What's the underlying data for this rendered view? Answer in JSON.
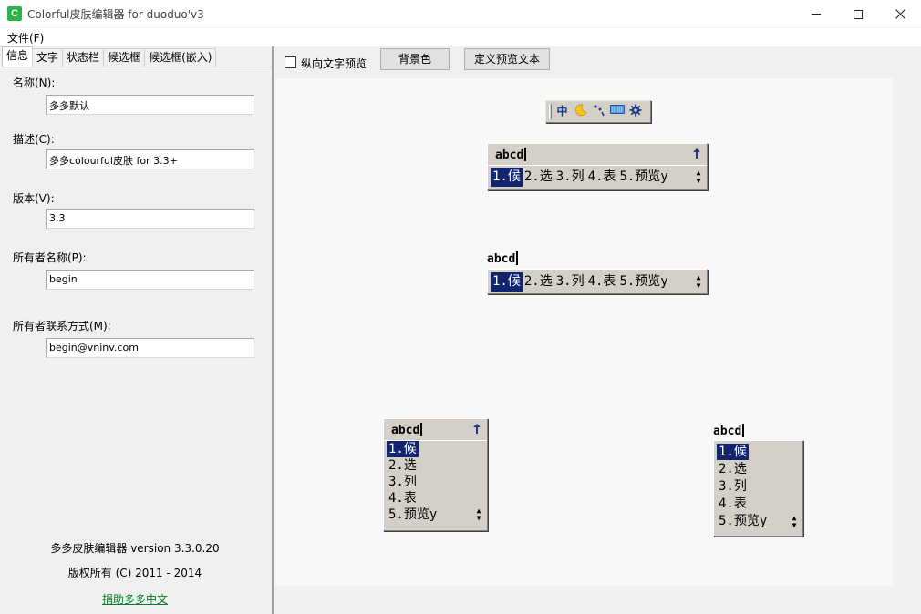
{
  "window": {
    "title": "Colorful皮肤编辑器 for duoduo'v3",
    "app_icon": "C"
  },
  "menu": {
    "file": "文件(F)"
  },
  "tabs": [
    "信息",
    "文字",
    "状态栏",
    "候选框",
    "候选框(嵌入)"
  ],
  "info": {
    "name_label": "名称(N):",
    "name_value": "多多默认",
    "desc_label": "描述(C):",
    "desc_value": "多多colourful皮肤 for 3.3+",
    "version_label": "版本(V):",
    "version_value": "3.3",
    "owner_label": "所有者名称(P):",
    "owner_value": "begin",
    "contact_label": "所有者联系方式(M):",
    "contact_value": "begin@vninv.com"
  },
  "footer": {
    "version": "多多皮肤编辑器 version 3.3.0.20",
    "copyright": "版权所有 (C) 2011 - 2014",
    "donate": "捐助多多中文"
  },
  "toolbar": {
    "vertical_preview": "纵向文字预览",
    "vertical_checked": false,
    "bg_color": "背景色",
    "define_text": "定义预览文本"
  },
  "preview": {
    "status_icons": [
      "zhong-icon",
      "moon-icon",
      "punct-icon",
      "keyboard-icon",
      "gear-icon"
    ],
    "zhong": "中",
    "comp": "abcd",
    "candidates": [
      "1.候",
      "2.选",
      "3.列",
      "4.表",
      "5.预览y"
    ],
    "selected_index": 0
  },
  "colors": {
    "accent_green": "#2db34a",
    "selection": "#13246e",
    "panel": "#d4d0c8"
  }
}
